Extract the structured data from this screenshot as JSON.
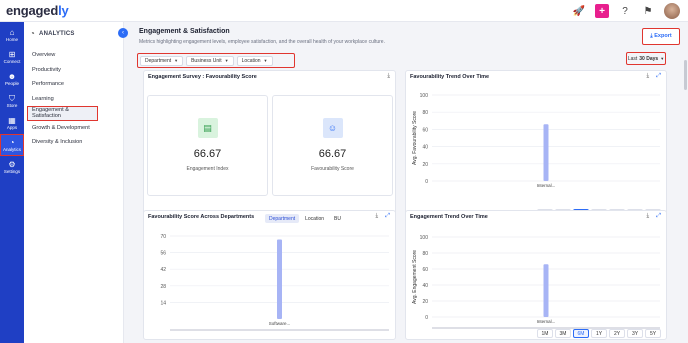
{
  "header": {
    "logo_main": "engaged",
    "logo_accent": "ly"
  },
  "rail": {
    "items": [
      {
        "label": "Home",
        "icon": "home-icon",
        "glyph": "⌂"
      },
      {
        "label": "Connect",
        "icon": "connect-icon",
        "glyph": "⊞"
      },
      {
        "label": "People",
        "icon": "people-icon",
        "glyph": "☻"
      },
      {
        "label": "Store",
        "icon": "store-icon",
        "glyph": "⛉"
      },
      {
        "label": "Apps",
        "icon": "apps-icon",
        "glyph": "▦"
      },
      {
        "label": "Analytics",
        "icon": "analytics-icon",
        "glyph": "◔"
      },
      {
        "label": "Settings",
        "icon": "settings-icon",
        "glyph": "⚙"
      }
    ]
  },
  "sidebar": {
    "heading": "ANALYTICS",
    "items": [
      {
        "label": "Overview"
      },
      {
        "label": "Productivity"
      },
      {
        "label": "Performance"
      },
      {
        "label": "Learning"
      },
      {
        "label": "Engagement & Satisfaction"
      },
      {
        "label": "Growth & Development"
      },
      {
        "label": "Diversity & Inclusion"
      }
    ]
  },
  "page": {
    "title": "Engagement & Satisfaction",
    "subtitle": "Metrics highlighting engagement levels, employee satisfaction, and the overall health of your workplace culture.",
    "export_label": "Export",
    "range_prefix": "Last",
    "range_value": "30 Days"
  },
  "filters": [
    {
      "label": "Department"
    },
    {
      "label": "Business Unit"
    },
    {
      "label": "Location"
    }
  ],
  "survey": {
    "title": "Engagement Survey : Favourability Score",
    "engagement_index": {
      "value": "66.67",
      "label": "Engagement Index"
    },
    "favourability_score": {
      "value": "66.67",
      "label": "Favourability Score"
    }
  },
  "favourability_trend": {
    "title": "Favourability Trend Over Time",
    "timeframes": [
      "1M",
      "3M",
      "6M",
      "1Y",
      "2Y",
      "3Y",
      "5Y"
    ],
    "selected_timeframe": "6M"
  },
  "dept_scores": {
    "title": "Favourability Score Across Departments",
    "toggles": [
      "Department",
      "Location",
      "BU"
    ],
    "selected_toggle": "Department"
  },
  "engagement_trend": {
    "title": "Engagement Trend Over Time",
    "timeframes": [
      "1M",
      "3M",
      "6M",
      "1Y",
      "2Y",
      "3Y",
      "5Y"
    ],
    "selected_timeframe": "6M"
  },
  "chart_data": [
    {
      "type": "bar",
      "title": "Favourability Trend Over Time",
      "categories": [
        "Internal..."
      ],
      "values": [
        66
      ],
      "xlabel": "",
      "ylabel": "Avg. Favourability Score",
      "ylim": [
        0,
        100
      ],
      "yticks": [
        0,
        20,
        40,
        60,
        80,
        100
      ],
      "grid": true,
      "color": "#a7b4f5"
    },
    {
      "type": "bar",
      "title": "Favourability Score Across Departments",
      "categories": [
        "Software..."
      ],
      "values": [
        67
      ],
      "xlabel": "",
      "ylabel": "",
      "ylim": [
        0,
        70
      ],
      "yticks": [
        70,
        56,
        42,
        28,
        14
      ],
      "grid": true,
      "color": "#a7b4f5"
    },
    {
      "type": "bar",
      "title": "Engagement Trend Over Time",
      "categories": [
        "Internal..."
      ],
      "values": [
        66
      ],
      "xlabel": "",
      "ylabel": "Avg. Engagement Score",
      "ylim": [
        0,
        100
      ],
      "yticks": [
        0,
        20,
        40,
        60,
        80,
        100
      ],
      "grid": true,
      "color": "#a7b4f5"
    }
  ]
}
